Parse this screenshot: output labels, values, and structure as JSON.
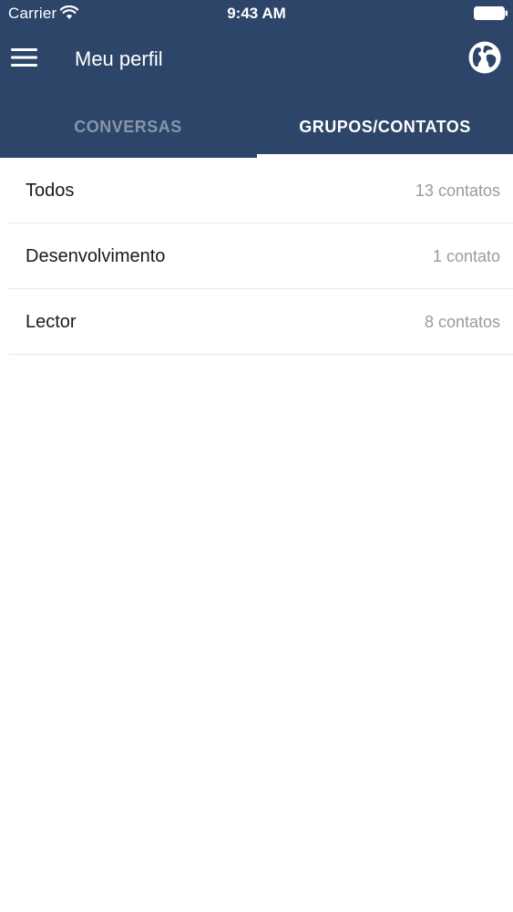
{
  "status_bar": {
    "carrier": "Carrier",
    "time": "9:43 AM",
    "icons": [
      "wifi-icon",
      "battery-icon"
    ]
  },
  "nav": {
    "title": "Meu perfil",
    "left_icon": "menu-icon",
    "right_icon": "globe-icon"
  },
  "tabs": [
    {
      "label": "CONVERSAS",
      "active": false
    },
    {
      "label": "GRUPOS/CONTATOS",
      "active": true
    }
  ],
  "groups": [
    {
      "name": "Todos",
      "count": "13 contatos"
    },
    {
      "name": "Desenvolvimento",
      "count": "1 contato"
    },
    {
      "name": "Lector",
      "count": "8 contatos"
    }
  ],
  "colors": {
    "header": "#2c4569",
    "tab_inactive": "#8796ab",
    "tab_active": "#ffffff",
    "count_text": "#9b9b9f"
  }
}
